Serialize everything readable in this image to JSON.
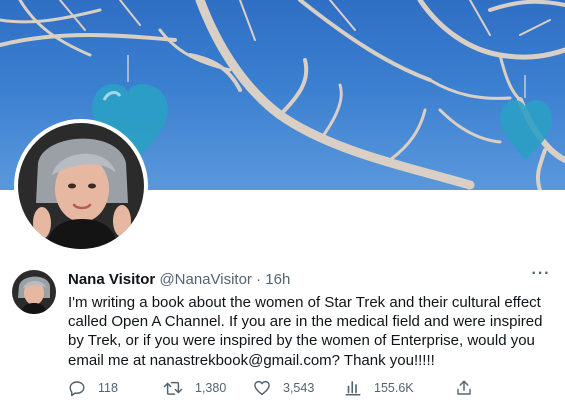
{
  "tweet": {
    "display_name": "Nana Visitor",
    "handle": "@NanaVisitor",
    "separator": "·",
    "timestamp": "16h",
    "more_label": "···",
    "text": "I'm writing a book about the women of Star Trek and their cultural effect called Open A Channel. If you are in the medical field and were inspired by Trek, or if you were inspired by the women of Enterprise, would you email me at nanastrekbook@gmail.com? Thank you!!!!!",
    "actions": {
      "reply": {
        "icon": "reply-icon",
        "count": "118"
      },
      "retweet": {
        "icon": "retweet-icon",
        "count": "1,380"
      },
      "like": {
        "icon": "heart-icon",
        "count": "3,543"
      },
      "views": {
        "icon": "views-icon",
        "count": "155.6K"
      },
      "share": {
        "icon": "share-icon"
      }
    }
  },
  "colors": {
    "text": "#0f1419",
    "secondary": "#536471",
    "sky": "#3b7fd0",
    "heart_glass": "#2a9fc4"
  }
}
